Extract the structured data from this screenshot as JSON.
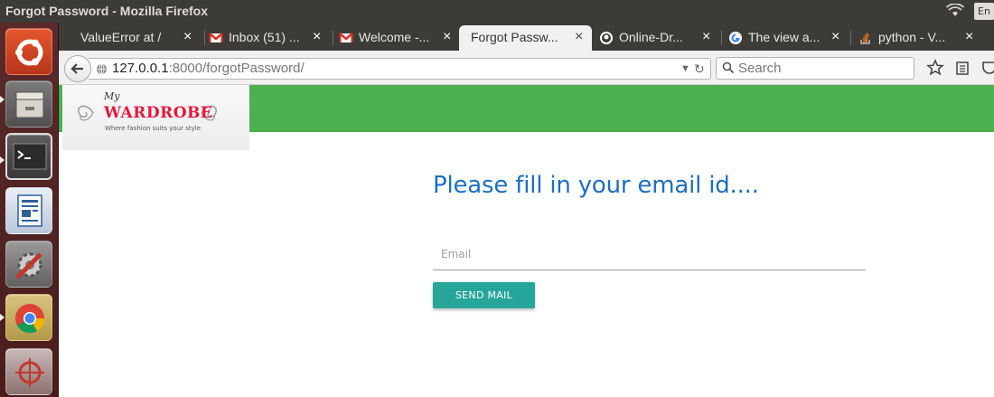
{
  "window": {
    "title": "Forgot Password - Mozilla Firefox",
    "keyboard_layout": "En"
  },
  "launcher": {
    "items": [
      "ubuntu-dash",
      "files",
      "terminal",
      "libreoffice-writer",
      "system-settings",
      "chrome",
      "screenshot-tool"
    ]
  },
  "tabs": [
    {
      "label": "ValueError at /",
      "icon": "none",
      "active": false
    },
    {
      "label": "Inbox (51) ...",
      "icon": "gmail-icon",
      "active": false
    },
    {
      "label": "Welcome -...",
      "icon": "gmail-icon",
      "active": false
    },
    {
      "label": "Forgot Passw...",
      "icon": "none",
      "active": true
    },
    {
      "label": "Online-Dr...",
      "icon": "github-icon",
      "active": false
    },
    {
      "label": "The view a...",
      "icon": "google-icon",
      "active": false
    },
    {
      "label": "python - V...",
      "icon": "stackoverflow-icon",
      "active": false
    }
  ],
  "tab_close_glyph": "×",
  "nav": {
    "url_host": "127.0.0.1",
    "url_rest": ":8000/forgotPassword/",
    "search_placeholder": "Search"
  },
  "page": {
    "logo": {
      "my": "My",
      "brand": "WARDROBE",
      "tagline": "Where fashion suits your style"
    },
    "heading": "Please fill in your email id....",
    "email_placeholder": "Email",
    "send_button": "SEND MAIL",
    "colors": {
      "header_green": "#4caf50",
      "heading_blue": "#1e6fbf",
      "button_teal": "#26a69a"
    }
  }
}
